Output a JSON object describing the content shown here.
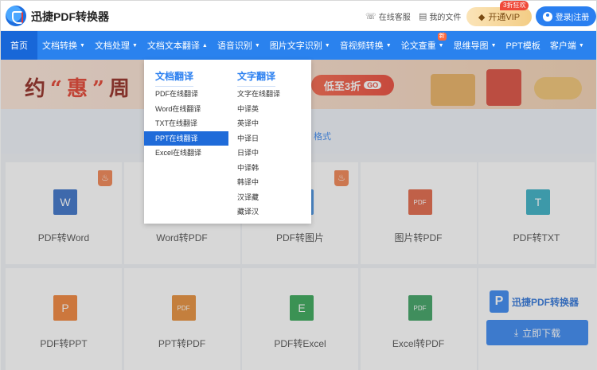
{
  "header": {
    "brand": "迅捷PDF转换器",
    "service_label": "在线客服",
    "files_label": "我的文件",
    "vip_label": "开通VIP",
    "vip_badge": "3折狂欢",
    "login_label": "登录|注册"
  },
  "nav": {
    "items": [
      {
        "label": "首页",
        "active": true,
        "dropdown": false
      },
      {
        "label": "文档转换",
        "dropdown": true
      },
      {
        "label": "文档处理",
        "dropdown": true
      },
      {
        "label": "文档文本翻译",
        "dropdown": true,
        "open": true
      },
      {
        "label": "语音识别",
        "dropdown": true
      },
      {
        "label": "图片文字识别",
        "dropdown": true
      },
      {
        "label": "音视频转换",
        "dropdown": true
      },
      {
        "label": "论文查重",
        "dropdown": true,
        "badge": "新"
      },
      {
        "label": "思维导图",
        "dropdown": true
      },
      {
        "label": "PPT模板",
        "dropdown": false
      },
      {
        "label": "客户端",
        "dropdown": true
      }
    ]
  },
  "banner": {
    "title_a": "约",
    "title_b": "“惠”",
    "title_c": "周",
    "pill": "低至3折",
    "pill_go": "GO"
  },
  "band": {
    "text": "格式"
  },
  "dropdown": {
    "col1_title": "文档翻译",
    "col1_items": [
      "PDF在线翻译",
      "Word在线翻译",
      "TXT在线翻译",
      "PPT在线翻译",
      "Excel在线翻译"
    ],
    "col1_selected": "PPT在线翻译",
    "col2_title": "文字翻译",
    "col2_items": [
      "文字在线翻译",
      "中译英",
      "英译中",
      "中译日",
      "日译中",
      "中译韩",
      "韩译中",
      "汉译藏",
      "藏译汉"
    ]
  },
  "tools_row1": [
    {
      "label": "PDF转Word",
      "icon": "W",
      "color": "#2b67c4",
      "hot": true
    },
    {
      "label": "Word转PDF",
      "icon": "PDF",
      "color": "#d94a3a",
      "hot": false
    },
    {
      "label": "PDF转图片",
      "icon": "IMG",
      "color": "#3d8fe6",
      "hot": true
    },
    {
      "label": "图片转PDF",
      "icon": "PDF",
      "color": "#e05a3a",
      "hot": false
    },
    {
      "label": "PDF转TXT",
      "icon": "T",
      "color": "#2aa9c0",
      "hot": false
    }
  ],
  "tools_row2": [
    {
      "label": "PDF转PPT",
      "icon": "P",
      "color": "#f07a2a"
    },
    {
      "label": "PPT转PDF",
      "icon": "PDF",
      "color": "#e5862a"
    },
    {
      "label": "PDF转Excel",
      "icon": "E",
      "color": "#27a04a"
    },
    {
      "label": "Excel转PDF",
      "icon": "PDF",
      "color": "#2f9a56"
    }
  ],
  "promo": {
    "logo": "P",
    "name": "迅捷PDF转换器",
    "download_label": "立即下载"
  }
}
